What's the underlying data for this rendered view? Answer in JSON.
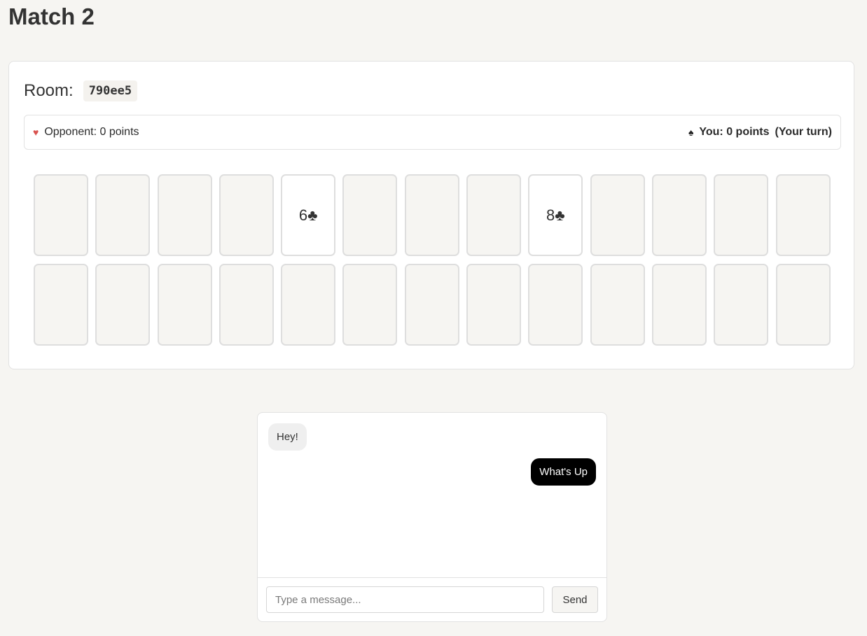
{
  "page": {
    "title": "Match 2"
  },
  "room": {
    "label": "Room:",
    "code": "790ee5"
  },
  "scoreboard": {
    "opponent_icon": "heart-icon",
    "opponent_text": "Opponent: 0 points",
    "you_icon": "spade-icon",
    "you_text": "You: 0 points",
    "turn_text": "(Your turn)"
  },
  "board": {
    "rows": 2,
    "columns": 13,
    "cards": [
      "",
      "",
      "",
      "",
      "6♣",
      "",
      "",
      "",
      "8♣",
      "",
      "",
      "",
      "",
      "",
      "",
      "",
      "",
      "",
      "",
      "",
      "",
      "",
      "",
      "",
      "",
      ""
    ]
  },
  "chat": {
    "messages": [
      {
        "from": "opponent",
        "text": "Hey!"
      },
      {
        "from": "you",
        "text": "What's Up"
      }
    ],
    "input_placeholder": "Type a message...",
    "input_value": "",
    "send_label": "Send"
  },
  "colors": {
    "heart": "#d9534f",
    "outgoing_bubble": "#000000",
    "incoming_bubble": "#efefef"
  }
}
